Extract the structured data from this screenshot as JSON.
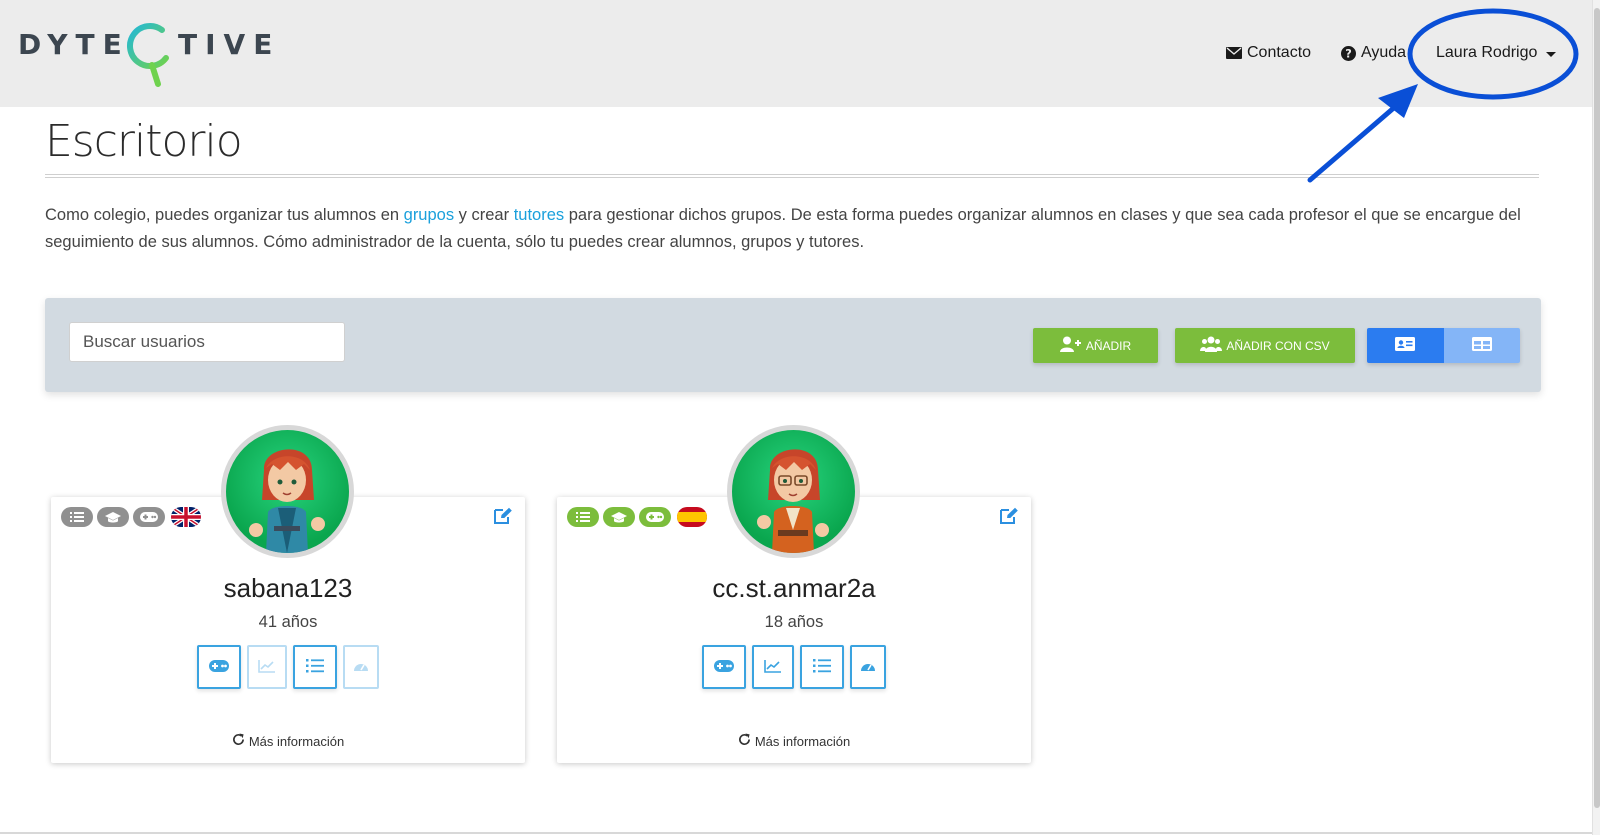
{
  "header": {
    "logo_left": "DYTE",
    "logo_right": "TIVE",
    "nav": {
      "contact": "Contacto",
      "help": "Ayuda",
      "user": "Laura Rodrigo"
    }
  },
  "page": {
    "title": "Escritorio",
    "intro": {
      "p1": "Como colegio, puedes organizar tus alumnos en ",
      "link_groups": "grupos",
      "p2": " y crear ",
      "link_tutors": "tutores",
      "p3": " para gestionar dichos grupos. De esta forma puedes organizar alumnos en clases y que sea cada profesor el que se encargue del seguimiento de sus alumnos. Cómo administrador de la cuenta, sólo tu puedes crear alumnos, grupos y tutores."
    }
  },
  "toolbar": {
    "search_placeholder": "Buscar usuarios",
    "add_label": "AÑADIR",
    "add_csv_label": "AÑADIR CON CSV",
    "active_view": "cards"
  },
  "colors": {
    "accent_green": "#7cbd3c",
    "accent_blue": "#2b7cf0",
    "link_blue": "#1aa0dc",
    "annotation_blue": "#0a4fd6"
  },
  "users": [
    {
      "username": "sabana123",
      "age": "41 años",
      "badge_state": "inactive",
      "language_flag": "uk-flag",
      "more_info": "Más información",
      "actions": [
        {
          "icon": "gamepad-icon",
          "enabled": true
        },
        {
          "icon": "chart-line-icon",
          "enabled": false
        },
        {
          "icon": "list-icon",
          "enabled": true
        },
        {
          "icon": "speedometer-icon",
          "enabled": false
        }
      ]
    },
    {
      "username": "cc.st.anmar2a",
      "age": "18 años",
      "badge_state": "active",
      "language_flag": "spain-flag",
      "more_info": "Más información",
      "actions": [
        {
          "icon": "gamepad-icon",
          "enabled": true
        },
        {
          "icon": "chart-line-icon",
          "enabled": true
        },
        {
          "icon": "list-icon",
          "enabled": true
        },
        {
          "icon": "speedometer-icon",
          "enabled": true
        }
      ]
    }
  ]
}
